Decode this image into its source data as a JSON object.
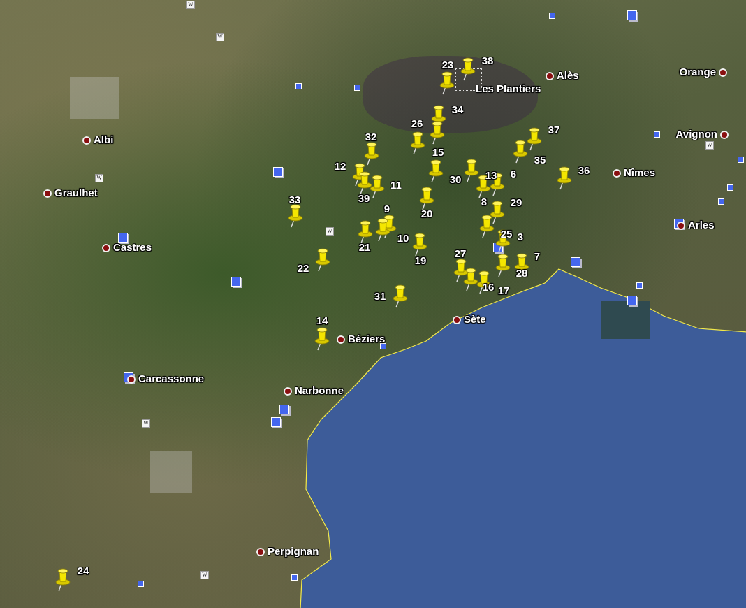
{
  "cities": [
    {
      "name": "Alès"
    },
    {
      "name": "Orange"
    },
    {
      "name": "Les Plantiers"
    },
    {
      "name": "Avignon"
    },
    {
      "name": "Albi"
    },
    {
      "name": "Nîmes"
    },
    {
      "name": "Graulhet"
    },
    {
      "name": "Arles"
    },
    {
      "name": "Castres"
    },
    {
      "name": "Sète"
    },
    {
      "name": "Béziers"
    },
    {
      "name": "Carcassonne"
    },
    {
      "name": "Narbonne"
    },
    {
      "name": "Perpignan"
    }
  ],
  "pin_labels": [
    "23",
    "38",
    "34",
    "26",
    "37",
    "32",
    "15",
    "35",
    "12",
    "30",
    "13",
    "6",
    "36",
    "11",
    "33",
    "39",
    "8",
    "29",
    "20",
    "9",
    "21",
    "10",
    "25",
    "3",
    "19",
    "27",
    "7",
    "22",
    "28",
    "16",
    "17",
    "31",
    "14",
    "24"
  ],
  "info_tiles": [
    {
      "label": "W"
    },
    {
      "label": "W"
    },
    {
      "label": "W"
    },
    {
      "label": "W"
    },
    {
      "label": "W"
    },
    {
      "label": "W"
    },
    {
      "label": "W"
    }
  ]
}
